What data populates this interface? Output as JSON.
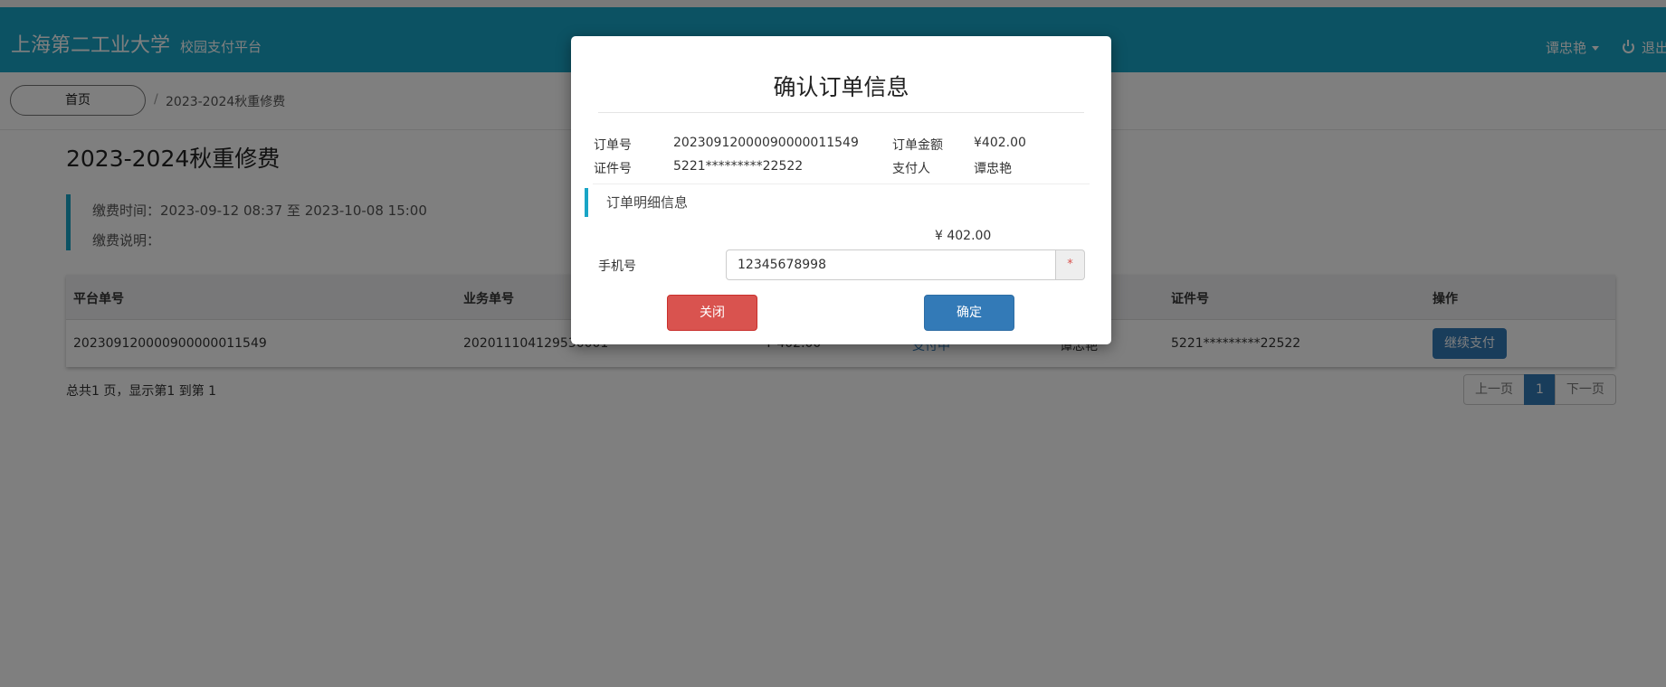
{
  "navbar": {
    "brand": "上海第二工业大学",
    "brand_sub": "校园支付平台",
    "user": "谭忠艳",
    "logout": "退出",
    "color": "#19a5c6"
  },
  "breadcrumb": {
    "home": "首页",
    "separator": "/",
    "current": "2023-2024秋重修费"
  },
  "page": {
    "title": "2023-2024秋重修费",
    "pay_time": "缴费时间：2023-09-12 08:37 至 2023-10-08 15:00",
    "pay_note": "缴费说明："
  },
  "table": {
    "headers": [
      "平台单号",
      "业务单号",
      "",
      "",
      "",
      "证件号",
      "操作"
    ],
    "row": {
      "platform_no": "20230912000090000001154​9",
      "business_no": "20201110412953000​1",
      "amount": "¥ 402.00",
      "status": "支付中",
      "payer": "谭忠艳",
      "id_no": "5221*********22522",
      "action": "继续支付"
    }
  },
  "summary": "总共1 页，显示第1 到第 1",
  "pager": {
    "prev": "上一页",
    "current": "1",
    "next": "下一页"
  },
  "modal": {
    "title": "确认订单信息",
    "order_no_label": "订单号",
    "order_no": "20230912000090000011549",
    "amount_label": "订单金额",
    "amount": "¥402.00",
    "id_label": "证件号",
    "id_no": "5221*********22522",
    "payer_label": "支付人",
    "payer": "谭忠艳",
    "detail_header": "订单明细信息",
    "detail_amount": "¥ 402.00",
    "phone_label": "手机号",
    "phone_value": "12345678998",
    "required_mark": "*",
    "close": "关闭",
    "confirm": "确定"
  }
}
